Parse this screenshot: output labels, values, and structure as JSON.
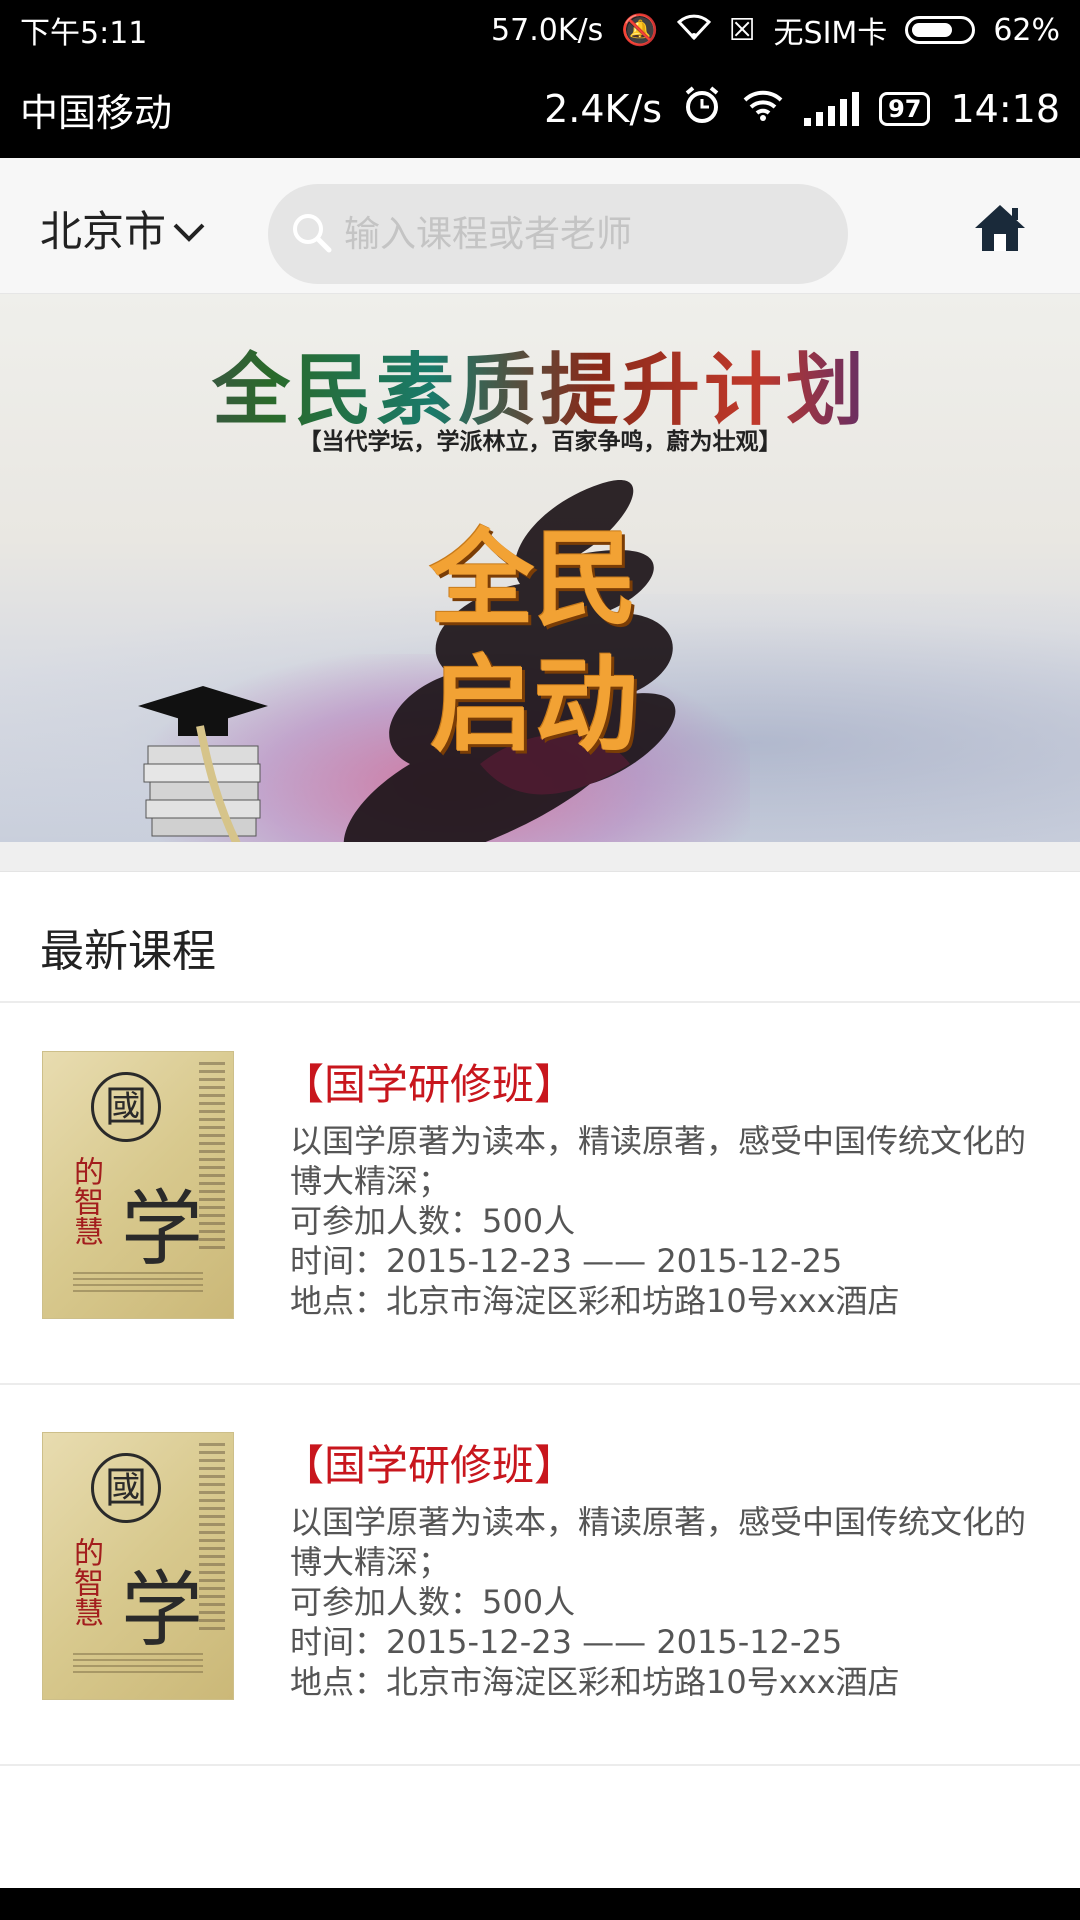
{
  "outer_status_bar": {
    "time": "下午5:11",
    "speed": "57.0K/s",
    "sim": "无SIM卡",
    "battery": "62%"
  },
  "inner_status_bar": {
    "carrier": "中国移动",
    "speed": "2.4K/s",
    "battery": "97",
    "time": "14:18"
  },
  "header": {
    "city": "北京市",
    "search_placeholder": "输入课程或者老师"
  },
  "banner": {
    "title": "全民素质提升计划",
    "subtitle": "【当代学坛，学派林立，百家争鸣，蔚为壮观】",
    "big_line1": "全民",
    "big_line2": "启动"
  },
  "section": {
    "title": "最新课程"
  },
  "courses": [
    {
      "title": "【国学研修班】",
      "description": "以国学原著为读本，精读原著，感受中国传统文化的博大精深；",
      "capacity": "可参加人数：500人",
      "time": "时间：2015-12-23 —— 2015-12-25",
      "location": "地点：北京市海淀区彩和坊路10号xxx酒店",
      "cover": {
        "seal": "國",
        "char": "学",
        "side": "的智慧"
      }
    },
    {
      "title": "【国学研修班】",
      "description": "以国学原著为读本，精读原著，感受中国传统文化的博大精深；",
      "capacity": "可参加人数：500人",
      "time": "时间：2015-12-23 —— 2015-12-25",
      "location": "地点：北京市海淀区彩和坊路10号xxx酒店",
      "cover": {
        "seal": "國",
        "char": "学",
        "side": "的智慧"
      }
    }
  ],
  "colors": {
    "accent_red": "#c8161d",
    "banner_orange": "#f2a234"
  }
}
